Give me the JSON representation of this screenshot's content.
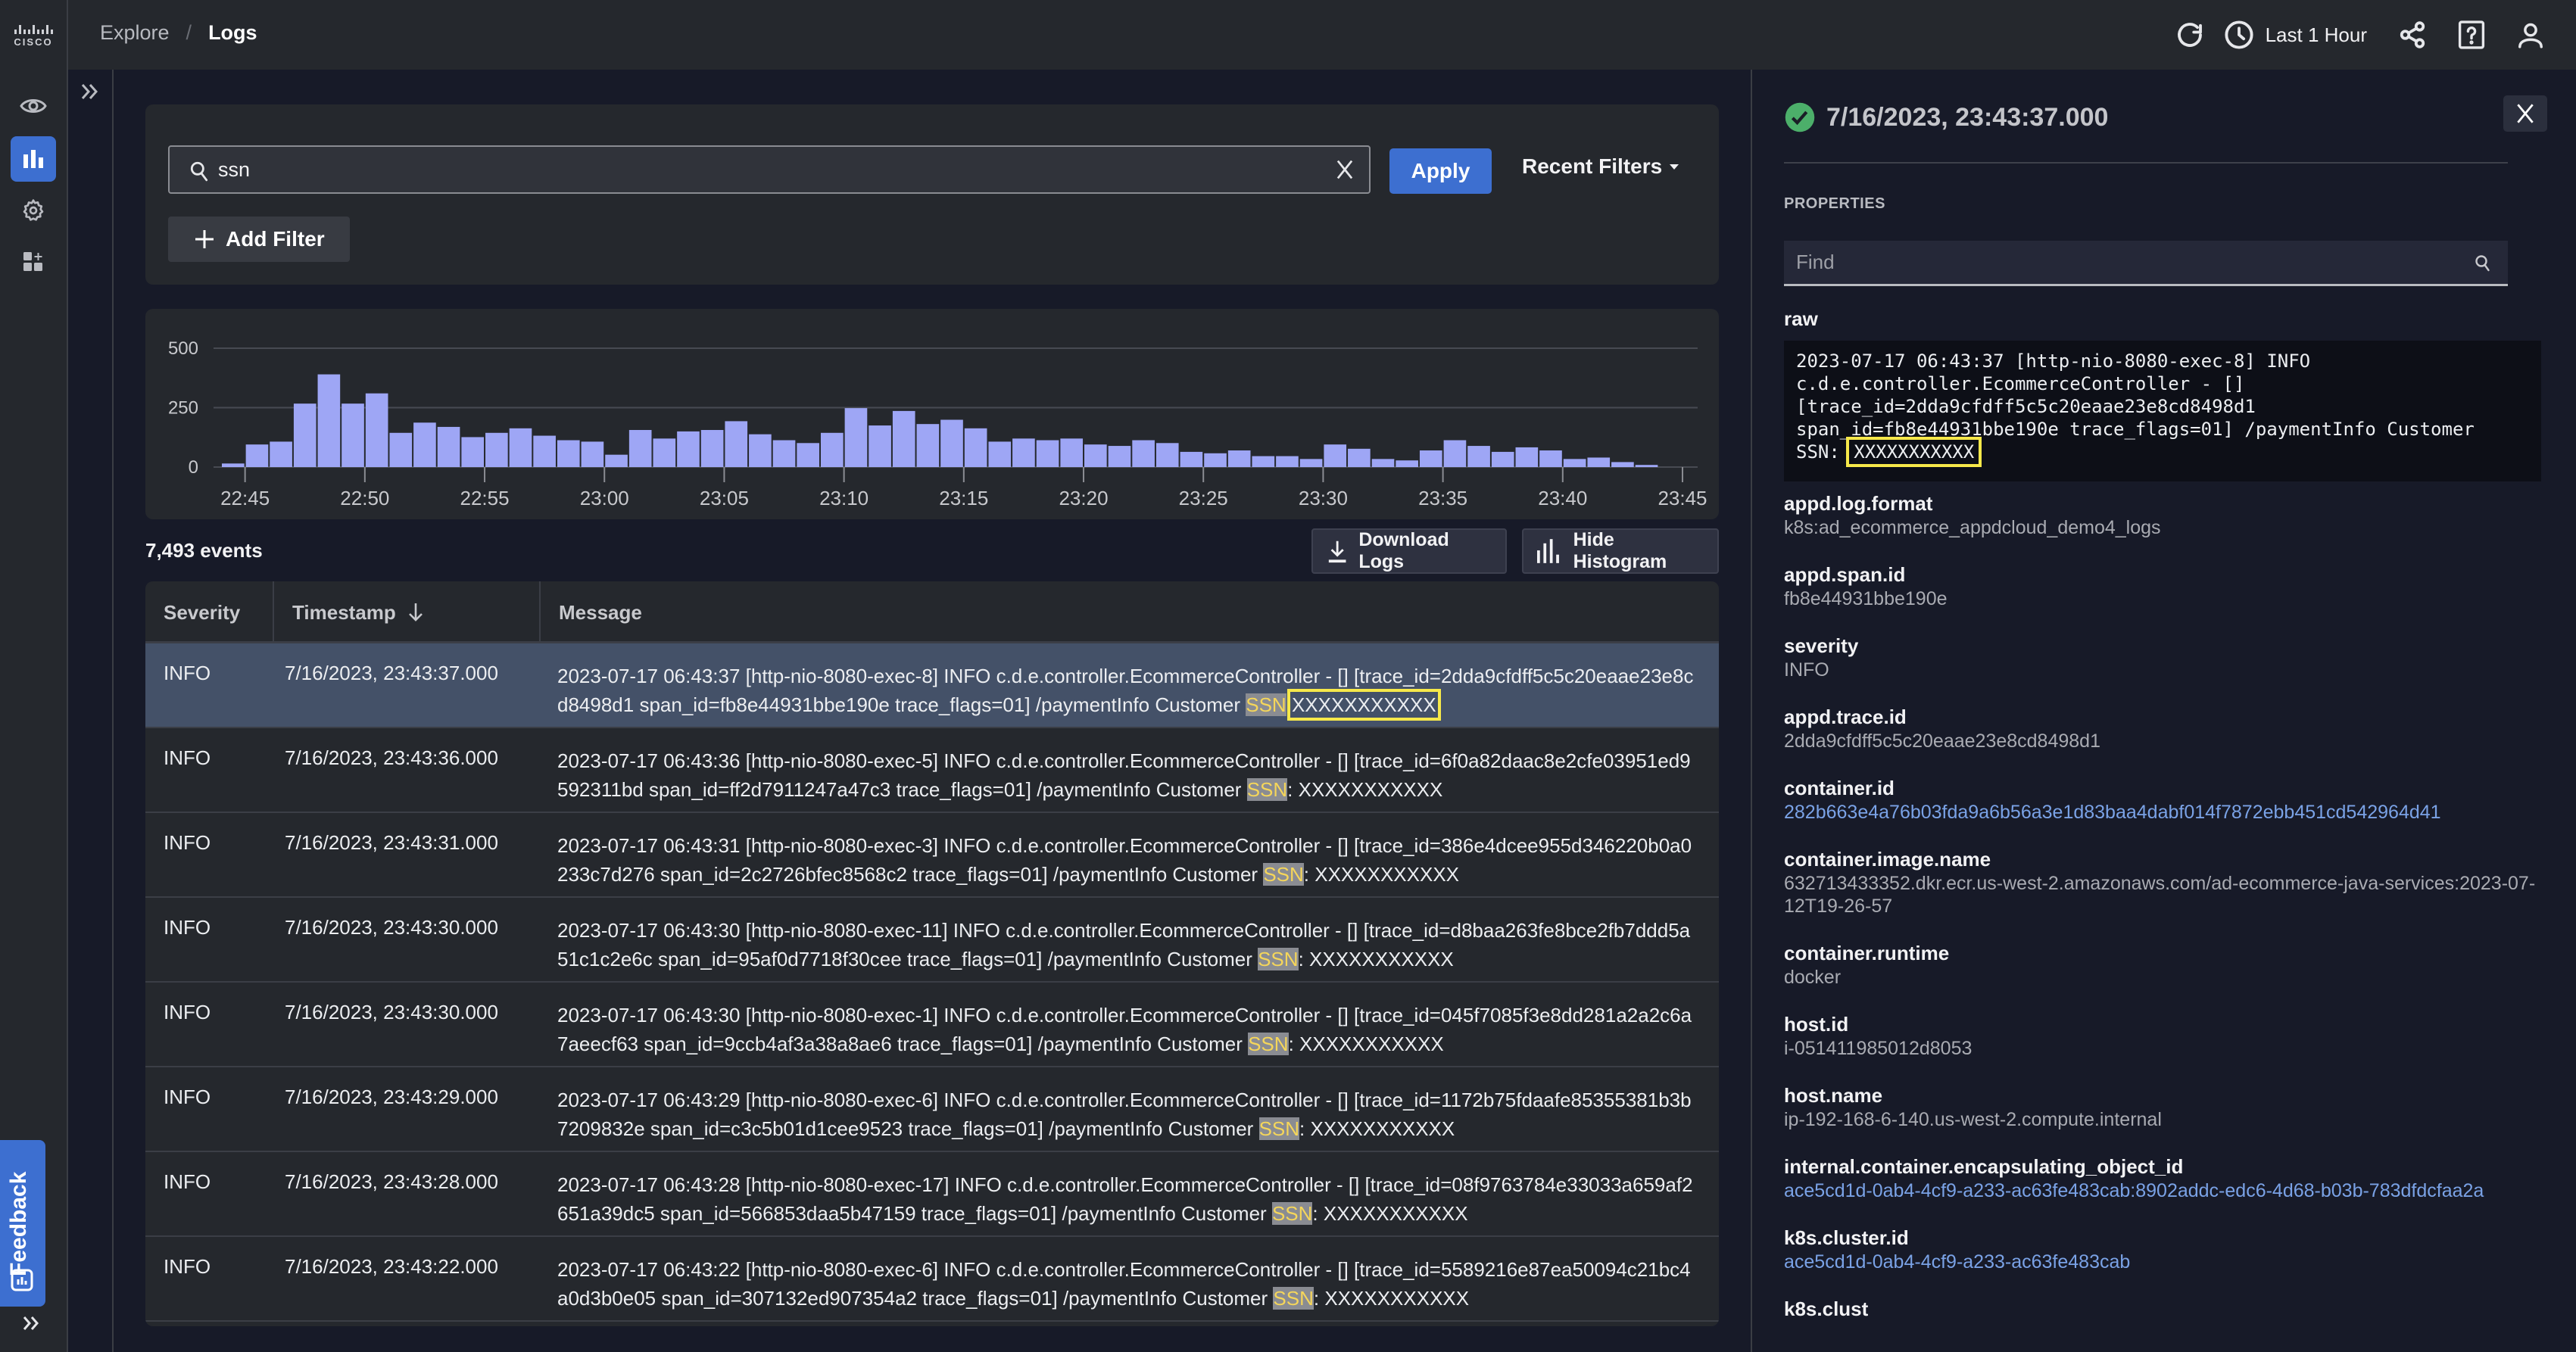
{
  "header": {
    "logo_text": "CISCO",
    "breadcrumb": [
      "Explore",
      "Logs"
    ],
    "breadcrumb_separator": "/",
    "time_range": "Last 1 Hour",
    "icons": [
      "refresh-icon",
      "clock-icon",
      "share-icon",
      "help-icon",
      "user-icon"
    ]
  },
  "leftnav": {
    "items": [
      {
        "name": "observe",
        "icon": "eye-icon",
        "active": false
      },
      {
        "name": "explore",
        "icon": "bar-chart-icon",
        "active": true
      },
      {
        "name": "configure",
        "icon": "gear-icon",
        "active": false
      },
      {
        "name": "add-widgets",
        "icon": "grid-plus-icon",
        "active": false
      }
    ],
    "feedback_label": "Feedback",
    "expand_icon": "double-chevron-right-icon"
  },
  "filter": {
    "query": "ssn",
    "apply_label": "Apply",
    "recent_filters_label": "Recent Filters",
    "add_filter_label": "Add Filter"
  },
  "chart_data": {
    "type": "bar",
    "title": "",
    "xlabel": "",
    "ylabel": "",
    "ylim": [
      0,
      500
    ],
    "yticks": [
      0,
      250,
      500
    ],
    "xtick_labels": [
      "22:45",
      "22:50",
      "22:55",
      "23:00",
      "23:05",
      "23:10",
      "23:15",
      "23:20",
      "23:25",
      "23:30",
      "23:35",
      "23:40",
      "23:45"
    ],
    "bin_start": "22:44",
    "bin_minutes": 1,
    "values": [
      15,
      95,
      107,
      267,
      390,
      267,
      310,
      144,
      187,
      169,
      126,
      144,
      163,
      132,
      113,
      107,
      52,
      156,
      120,
      150,
      156,
      193,
      138,
      113,
      101,
      144,
      248,
      175,
      236,
      181,
      199,
      163,
      107,
      120,
      113,
      120,
      95,
      89,
      113,
      101,
      64,
      58,
      70,
      46,
      46,
      34,
      95,
      77,
      34,
      28,
      70,
      113,
      89,
      64,
      83,
      70,
      34,
      40,
      21,
      9
    ],
    "grid": true,
    "bar_color": "#9ea6f5"
  },
  "results": {
    "count_label": "7,493 events",
    "download_label": "Download Logs",
    "hide_histogram_label": "Hide Histogram"
  },
  "table": {
    "columns": [
      "Severity",
      "Timestamp",
      "Message"
    ],
    "sort_column": "Timestamp",
    "sort_direction": "desc",
    "rows": [
      {
        "severity": "INFO",
        "timestamp": "7/16/2023, 23:43:37.000",
        "msg_pre": "2023-07-17 06:43:37 [http-nio-8080-exec-8] INFO  c.d.e.controller.EcommerceController - [] [trace_id=2dda9cfdff5c5c20eaae23e8cd8498d1 span_id=fb8e44931bbe190e trace_flags=01] /paymentInfo Customer ",
        "msg_hl": "SSN",
        "msg_post": ":",
        "msg_redacted": "XXXXXXXXXXX",
        "selected": true
      },
      {
        "severity": "INFO",
        "timestamp": "7/16/2023, 23:43:36.000",
        "msg_pre": "2023-07-17 06:43:36 [http-nio-8080-exec-5] INFO  c.d.e.controller.EcommerceController - [] [trace_id=6f0a82daac8e2cfe03951ed9592311bd span_id=ff2d7911247a47c3 trace_flags=01] /paymentInfo Customer ",
        "msg_hl": "SSN",
        "msg_post": ": ",
        "msg_redacted": "XXXXXXXXXXX",
        "selected": false
      },
      {
        "severity": "INFO",
        "timestamp": "7/16/2023, 23:43:31.000",
        "msg_pre": "2023-07-17 06:43:31 [http-nio-8080-exec-3] INFO  c.d.e.controller.EcommerceController - [] [trace_id=386e4dcee955d346220b0a0233c7d276 span_id=2c2726bfec8568c2 trace_flags=01] /paymentInfo Customer ",
        "msg_hl": "SSN",
        "msg_post": ": ",
        "msg_redacted": "XXXXXXXXXXX",
        "selected": false
      },
      {
        "severity": "INFO",
        "timestamp": "7/16/2023, 23:43:30.000",
        "msg_pre": "2023-07-17 06:43:30 [http-nio-8080-exec-11] INFO  c.d.e.controller.EcommerceController - [] [trace_id=d8baa263fe8bce2fb7ddd5a51c1c2e6c span_id=95af0d7718f30cee trace_flags=01] /paymentInfo Customer ",
        "msg_hl": "SSN",
        "msg_post": ": ",
        "msg_redacted": "XXXXXXXXXXX",
        "selected": false
      },
      {
        "severity": "INFO",
        "timestamp": "7/16/2023, 23:43:30.000",
        "msg_pre": "2023-07-17 06:43:30 [http-nio-8080-exec-1] INFO  c.d.e.controller.EcommerceController - [] [trace_id=045f7085f3e8dd281a2a2c6a7aeecf63 span_id=9ccb4af3a38a8ae6 trace_flags=01] /paymentInfo Customer ",
        "msg_hl": "SSN",
        "msg_post": ": ",
        "msg_redacted": "XXXXXXXXXXX",
        "selected": false
      },
      {
        "severity": "INFO",
        "timestamp": "7/16/2023, 23:43:29.000",
        "msg_pre": "2023-07-17 06:43:29 [http-nio-8080-exec-6] INFO  c.d.e.controller.EcommerceController - [] [trace_id=1172b75fdaafe85355381b3b7209832e span_id=c3c5b01d1cee9523 trace_flags=01] /paymentInfo Customer ",
        "msg_hl": "SSN",
        "msg_post": ": ",
        "msg_redacted": "XXXXXXXXXXX",
        "selected": false
      },
      {
        "severity": "INFO",
        "timestamp": "7/16/2023, 23:43:28.000",
        "msg_pre": "2023-07-17 06:43:28 [http-nio-8080-exec-17] INFO  c.d.e.controller.EcommerceController - [] [trace_id=08f9763784e33033a659af2651a39dc5 span_id=566853daa5b47159 trace_flags=01] /paymentInfo Customer ",
        "msg_hl": "SSN",
        "msg_post": ": ",
        "msg_redacted": "XXXXXXXXXXX",
        "selected": false
      },
      {
        "severity": "INFO",
        "timestamp": "7/16/2023, 23:43:22.000",
        "msg_pre": "2023-07-17 06:43:22 [http-nio-8080-exec-6] INFO  c.d.e.controller.EcommerceController - [] [trace_id=5589216e87ea50094c21bc4a0d3b0e05 span_id=307132ed907354a2 trace_flags=01] /paymentInfo Customer ",
        "msg_hl": "SSN",
        "msg_post": ": ",
        "msg_redacted": "XXXXXXXXXXX",
        "selected": false
      }
    ]
  },
  "detail": {
    "status": "success",
    "title": "7/16/2023, 23:43:37.000",
    "section_label": "PROPERTIES",
    "find_placeholder": "Find",
    "raw_label": "raw",
    "raw_pre": "2023-07-17 06:43:37 [http-nio-8080-exec-8] INFO\nc.d.e.controller.EcommerceController - []\n[trace_id=2dda9cfdff5c5c20eaae23e8cd8498d1\nspan_id=fb8e44931bbe190e trace_flags=01] /paymentInfo Customer\nSSN: ",
    "raw_redacted": "XXXXXXXXXXX",
    "properties": [
      {
        "key": "appd.log.format",
        "value": "k8s:ad_ecommerce_appdcloud_demo4_logs",
        "link": false
      },
      {
        "key": "appd.span.id",
        "value": "fb8e44931bbe190e",
        "link": false
      },
      {
        "key": "severity",
        "value": "INFO",
        "link": false
      },
      {
        "key": "appd.trace.id",
        "value": "2dda9cfdff5c5c20eaae23e8cd8498d1",
        "link": false
      },
      {
        "key": "container.id",
        "value": "282b663e4a76b03fda9a6b56a3e1d83baa4dabf014f7872ebb451cd542964d41",
        "link": true
      },
      {
        "key": "container.image.name",
        "value": "632713433352.dkr.ecr.us-west-2.amazonaws.com/ad-ecommerce-java-services:2023-07-12T19-26-57",
        "link": false
      },
      {
        "key": "container.runtime",
        "value": "docker",
        "link": false
      },
      {
        "key": "host.id",
        "value": "i-051411985012d8053",
        "link": false
      },
      {
        "key": "host.name",
        "value": "ip-192-168-6-140.us-west-2.compute.internal",
        "link": false
      },
      {
        "key": "internal.container.encapsulating_object_id",
        "value": "ace5cd1d-0ab4-4cf9-a233-ac63fe483cab:8902addc-edc6-4d68-b03b-783dfdcfaa2a",
        "link": true
      },
      {
        "key": "k8s.cluster.id",
        "value": "ace5cd1d-0ab4-4cf9-a233-ac63fe483cab",
        "link": true
      },
      {
        "key": "k8s.clust",
        "value": "",
        "link": false
      }
    ]
  },
  "colors": {
    "accent": "#3d6fd0",
    "bar": "#9ea6f5",
    "highlight": "#f5d65a",
    "redaction_outline": "#f6e84a",
    "link": "#7aa2e6",
    "success": "#4caf6a"
  }
}
